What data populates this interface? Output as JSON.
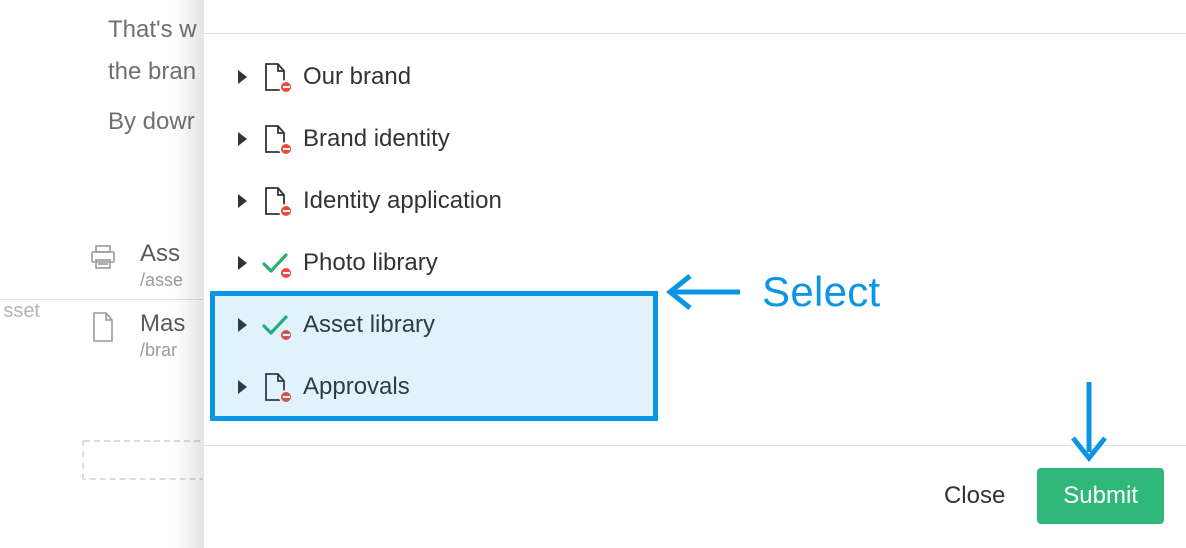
{
  "background": {
    "paragraph1": "That's w",
    "paragraph2": "the bran",
    "paragraph3": "By dowr",
    "side_label": "sset",
    "items": [
      {
        "title": "Ass",
        "path": "/asse",
        "icon": "printer-icon"
      },
      {
        "title": "Mas",
        "path": "/brar",
        "icon": "file-icon"
      }
    ]
  },
  "tree": {
    "items": [
      {
        "label": "Our brand",
        "selected": false
      },
      {
        "label": "Brand identity",
        "selected": false
      },
      {
        "label": "Identity application",
        "selected": false
      },
      {
        "label": "Photo library",
        "selected": true
      },
      {
        "label": "Asset library",
        "selected": true
      },
      {
        "label": "Approvals",
        "selected": false
      }
    ]
  },
  "annotation": {
    "select_label": "Select"
  },
  "footer": {
    "close_label": "Close",
    "submit_label": "Submit"
  },
  "colors": {
    "accent": "#0a96e4",
    "submit": "#2fb87a",
    "restrict": "#f04a3a",
    "check": "#2cb06e"
  }
}
